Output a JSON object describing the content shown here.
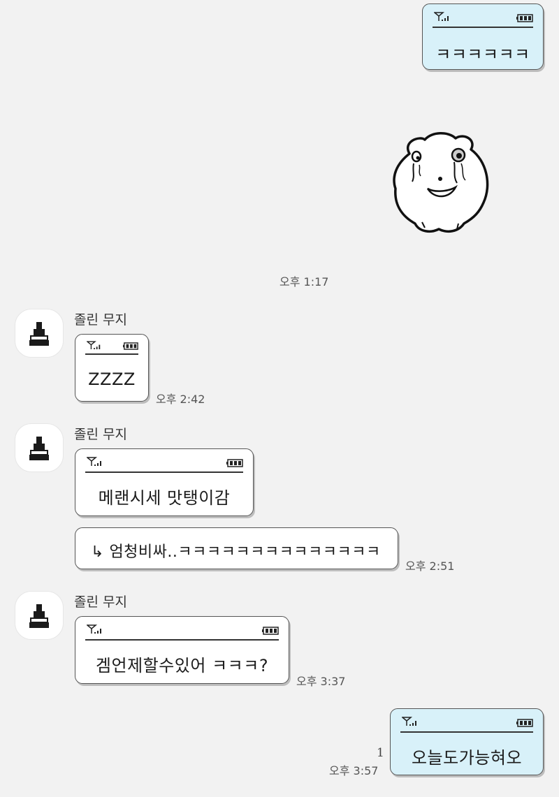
{
  "chat": {
    "messages": [
      {
        "sender": "me",
        "text": "ㅋㅋㅋㅋㅋㅋ"
      },
      {
        "sender": "me",
        "type": "sticker",
        "sticker": "crying-hamster-sticker"
      },
      {
        "sender": "other",
        "name": "졸린 무지",
        "text": "ZZZZ",
        "time": "오후 2:42"
      },
      {
        "sender": "other",
        "name": "졸린 무지",
        "text": "메랜시세 맛탱이감"
      },
      {
        "sender": "other",
        "type": "reply",
        "reply_arrow": "↳",
        "text": "엄청비싸..ㅋㅋㅋㅋㅋㅋㅋㅋㅋㅋㅋㅋㅋㅋ",
        "time": "오후 2:51"
      },
      {
        "sender": "other",
        "name": "졸린 무지",
        "text": "겜언제할수있어 ㅋㅋㅋ?",
        "time": "오후 3:37"
      },
      {
        "sender": "me",
        "text": "오늘도가능혀오",
        "time": "오후 3:57",
        "unread": "1"
      }
    ],
    "sticker_time": "오후 1:17"
  },
  "colors": {
    "background": "#f2f2f2",
    "my_bubble": "#d8f1f9",
    "other_bubble": "#ffffff"
  },
  "icons": {
    "signal": "signal-bars-icon",
    "battery": "battery-icon",
    "avatar": "muji-profile-icon"
  }
}
